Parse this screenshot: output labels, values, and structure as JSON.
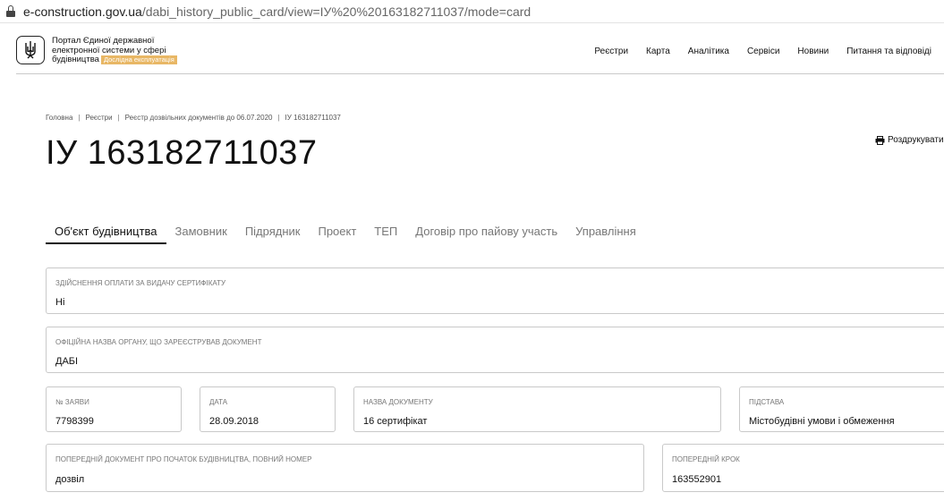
{
  "browser": {
    "url_domain": "e-construction.gov.ua",
    "url_path": "/dabi_history_public_card/view=ІУ%20%20163182711037/mode=card"
  },
  "header": {
    "portal_line1": "Портал Єдиної державної",
    "portal_line2": "електронної системи у сфері",
    "portal_line3": "будівництва",
    "beta_badge": "Дослідна експлуатація",
    "nav": [
      "Реєстри",
      "Карта",
      "Аналітика",
      "Сервіси",
      "Новини",
      "Питання та відповіді"
    ]
  },
  "breadcrumb": [
    "Головна",
    "Реєстри",
    "Реєстр дозвільних документів до 06.07.2020",
    "ІУ 163182711037"
  ],
  "page_title": "ІУ 163182711037",
  "print_label": "Роздрукувати",
  "tabs": [
    "Об'єкт будівництва",
    "Замовник",
    "Підрядник",
    "Проект",
    "ТЕП",
    "Договір про пайову участь",
    "Управління"
  ],
  "fields": {
    "payment": {
      "label": "Здійснення оплати за видачу сертифікату",
      "value": "Ні"
    },
    "organ": {
      "label": "Офіційна назва органу, що зареєстрував документ",
      "value": "ДАБІ"
    },
    "application_no": {
      "label": "№ заяви",
      "value": "7798399"
    },
    "date": {
      "label": "Дата",
      "value": "28.09.2018"
    },
    "doc_name": {
      "label": "Назва документу",
      "value": "16 сертифікат"
    },
    "basis": {
      "label": "Підстава",
      "value": "Містобудівні умови і обмеження"
    },
    "prev_doc": {
      "label": "Попередній документ про початок будівництва, повний номер",
      "value": "дозвіл"
    },
    "prev_step": {
      "label": "Попередній крок",
      "value": "163552901"
    }
  }
}
